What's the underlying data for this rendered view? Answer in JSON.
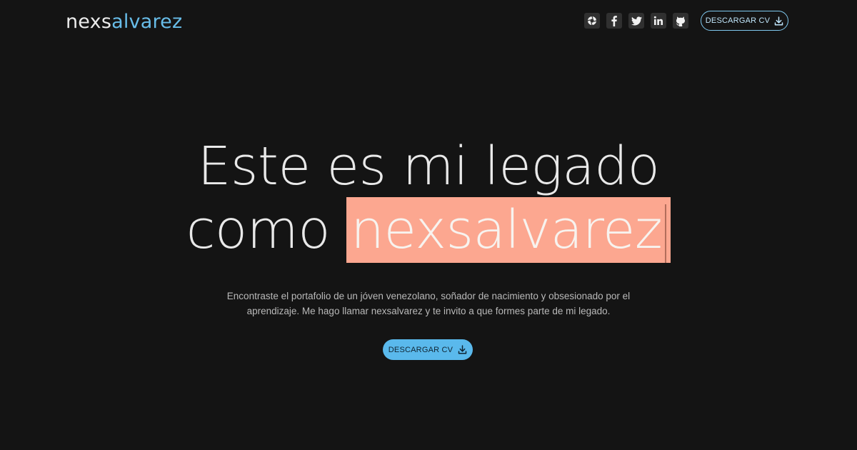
{
  "header": {
    "logo_part_1": "nexs",
    "logo_part_2": "alvarez",
    "social_icons": [
      "camera-aperture-icon",
      "facebook-icon",
      "twitter-icon",
      "linkedin-icon",
      "github-icon"
    ],
    "cv_button_label": "DESCARGAR CV"
  },
  "hero": {
    "line1": "Este es mi legado",
    "line2_prefix": "como ",
    "highlight": "nexsalvarez",
    "description_line1": "Encontraste el portafolio de un jóven venezolano, soñador de nacimiento y obsesionado por el",
    "description_line2": "aprendizaje. Me hago llamar nexsalvarez y te invito a que formes parte de mi legado.",
    "cta_label": "DESCARGAR CV"
  },
  "colors": {
    "background": "#141414",
    "accent_blue": "#5ab9ec",
    "highlight_salmon": "#fca790"
  }
}
